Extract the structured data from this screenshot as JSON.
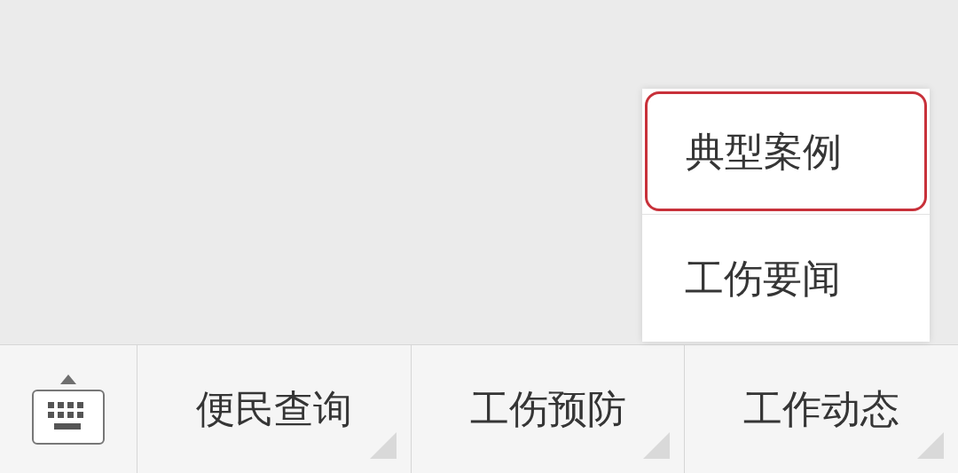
{
  "submenu": {
    "items": [
      {
        "label": "典型案例",
        "selected": true
      },
      {
        "label": "工伤要闻",
        "selected": false
      }
    ]
  },
  "menu_bar": {
    "items": [
      {
        "label": "便民查询",
        "has_submenu": true
      },
      {
        "label": "工伤预防",
        "has_submenu": true
      },
      {
        "label": "工作动态",
        "has_submenu": true
      }
    ]
  }
}
